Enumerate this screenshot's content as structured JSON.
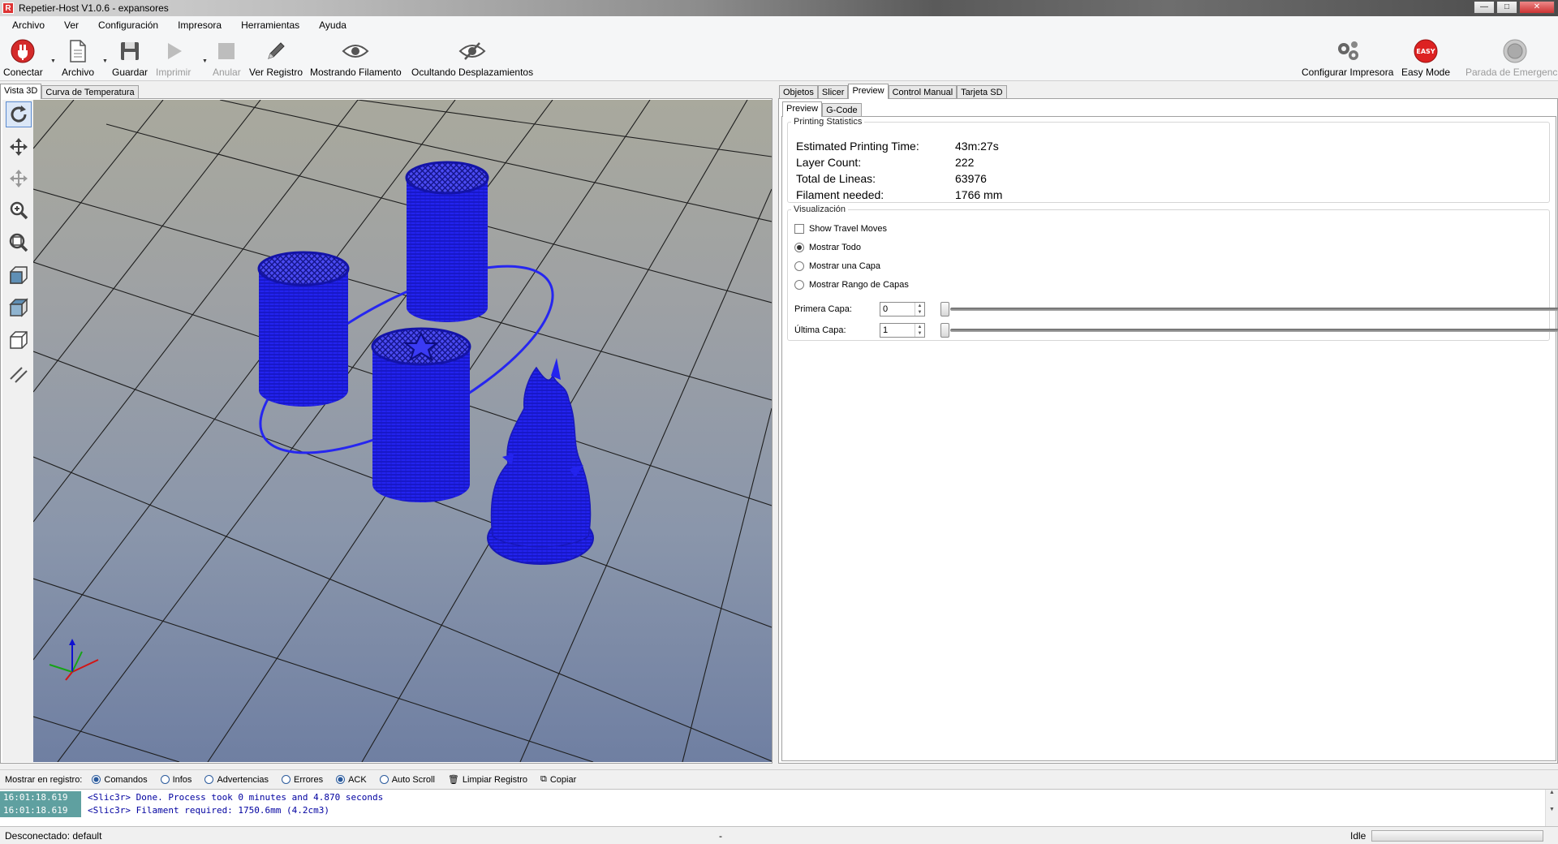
{
  "window": {
    "title": "Repetier-Host V1.0.6 - expansores",
    "app_icon_letter": "R",
    "buttons": [
      "—",
      "□",
      "✕"
    ]
  },
  "menu": [
    "Archivo",
    "Ver",
    "Configuración",
    "Impresora",
    "Herramientas",
    "Ayuda"
  ],
  "toolbar": {
    "connect": "Conectar",
    "file": "Archivo",
    "save": "Guardar",
    "print": "Imprimir",
    "cancel": "Anular",
    "view_log": "Ver Registro",
    "show_filament": "Mostrando Filamento",
    "hide_travel": "Ocultando Desplazamientos",
    "configure_printer": "Configurar Impresora",
    "easy_mode": "Easy Mode",
    "easy_badge": "EASY",
    "emergency_stop": "Parada de Emergencia"
  },
  "left_tabs": [
    "Vista 3D",
    "Curva de Temperatura"
  ],
  "right_tabs": [
    "Objetos",
    "Slicer",
    "Preview",
    "Control Manual",
    "Tarjeta SD"
  ],
  "sub_tabs": [
    "Preview",
    "G-Code"
  ],
  "stats": {
    "legend": "Printing Statistics",
    "rows": [
      {
        "label": "Estimated Printing Time:",
        "value": "43m:27s"
      },
      {
        "label": "Layer Count:",
        "value": "222"
      },
      {
        "label": "Total de Lineas:",
        "value": "63976"
      },
      {
        "label": "Filament needed:",
        "value": "1766 mm"
      }
    ]
  },
  "visualization": {
    "legend": "Visualización",
    "show_travel": "Show Travel Moves",
    "show_all": "Mostrar Todo",
    "show_one_layer": "Mostrar una Capa",
    "show_layer_range": "Mostrar Rango de Capas",
    "first_layer_label": "Primera Capa:",
    "first_layer_value": "0",
    "last_layer_label": "Última Capa:",
    "last_layer_value": "1"
  },
  "log": {
    "show_label": "Mostrar en registro:",
    "options": [
      "Comandos",
      "Infos",
      "Advertencias",
      "Errores",
      "ACK",
      "Auto Scroll"
    ],
    "clear": "Limpiar Registro",
    "copy": "Copiar",
    "lines": [
      {
        "time": "16:01:18.619",
        "msg": "<Slic3r> Done. Process took 0 minutes and 4.870 seconds"
      },
      {
        "time": "16:01:18.619",
        "msg": "<Slic3r> Filament required: 1750.6mm (4.2cm3)"
      }
    ]
  },
  "status": {
    "connection": "Desconectado: default",
    "middle": "-",
    "state": "Idle"
  },
  "colors": {
    "model": "#2222ee",
    "accent": "#2a5a9c"
  }
}
